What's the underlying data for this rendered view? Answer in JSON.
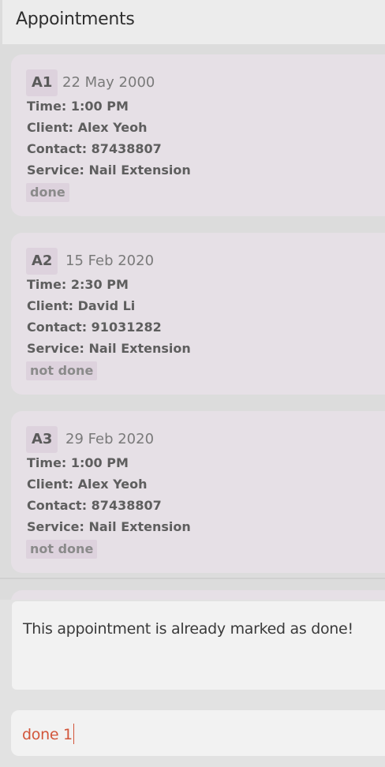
{
  "header": {
    "title": "Appointments"
  },
  "appointments": [
    {
      "id": "A1",
      "date": "22 May 2000",
      "time": "Time: 1:00 PM",
      "client": "Client: Alex Yeoh",
      "contact": "Contact: 87438807",
      "service": "Service: Nail Extension",
      "status": "done"
    },
    {
      "id": "A2",
      "date": "15 Feb 2020",
      "time": "Time: 2:30 PM",
      "client": "Client: David Li",
      "contact": "Contact: 91031282",
      "service": "Service: Nail Extension",
      "status": "not done"
    },
    {
      "id": "A3",
      "date": "29 Feb 2020",
      "time": "Time: 1:00 PM",
      "client": "Client: Alex Yeoh",
      "contact": "Contact: 87438807",
      "service": "Service: Nail Extension",
      "status": "not done"
    }
  ],
  "result": {
    "message": "This appointment is already marked as done!"
  },
  "command": {
    "value": "done 1"
  },
  "colors": {
    "card_background": "#e6e0e6",
    "badge_background": "#ddd2dd",
    "command_text": "#d2553a"
  }
}
